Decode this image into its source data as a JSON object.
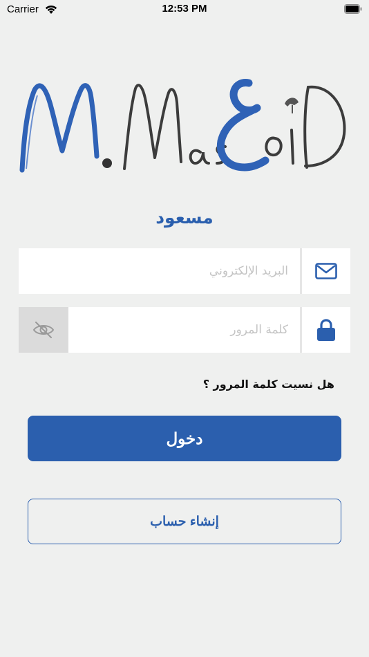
{
  "status_bar": {
    "carrier": "Carrier",
    "time": "12:53 PM"
  },
  "logo": {
    "text": "M.MasعoD"
  },
  "app_title": "مسعود",
  "email_field": {
    "placeholder": "البريد الإلكتروني",
    "value": "",
    "icon": "envelope-icon"
  },
  "password_field": {
    "placeholder": "كلمة المرور",
    "value": "",
    "icon": "lock-icon",
    "toggle_icon": "eye-slash-icon"
  },
  "forgot_password": "هل نسيت كلمة المرور ؟",
  "login_button": "دخول",
  "register_button": "إنشاء حساب",
  "colors": {
    "background": "#eff0ef",
    "primary": "#2b5fae",
    "logo_dark": "#3a3a3a"
  }
}
